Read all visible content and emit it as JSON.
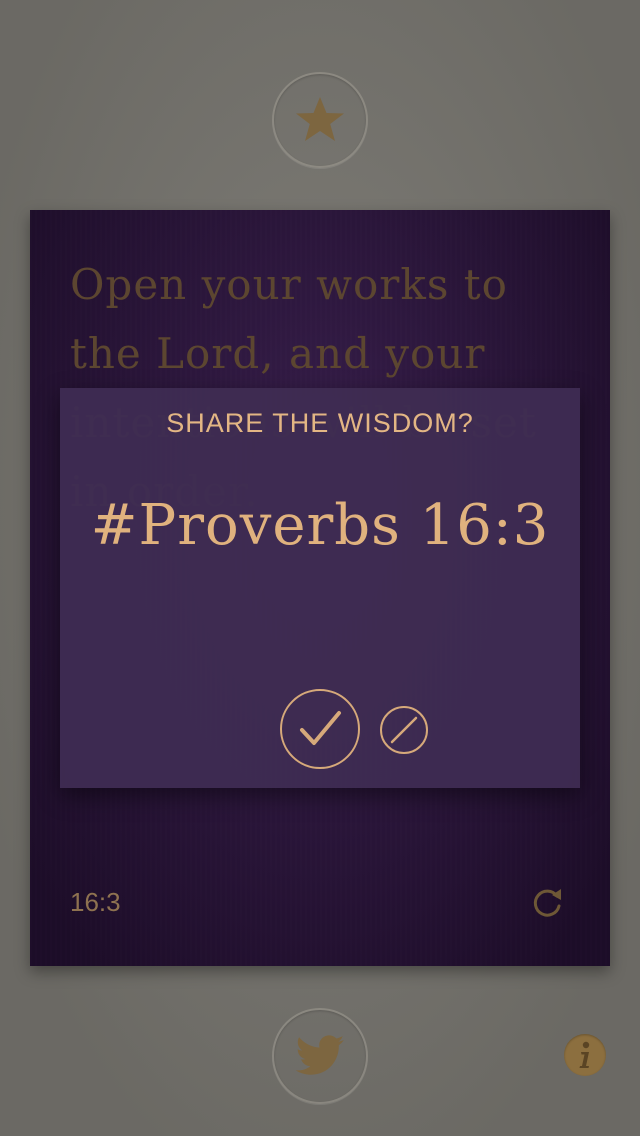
{
  "top_bar": {
    "favorite_icon": "star-icon"
  },
  "card": {
    "verse": "Open your works to the Lord, and your intentions will be set in order.",
    "reference": "16:3",
    "refresh_icon": "refresh-icon"
  },
  "share_dialog": {
    "title": "SHARE THE WISDOM?",
    "hashtag": "#Proverbs 16:3",
    "confirm_icon": "checkmark-icon",
    "cancel_icon": "cancel-icon"
  },
  "bottom_bar": {
    "share_icon": "twitter-icon",
    "info_icon": "info-icon"
  },
  "colors": {
    "background": "#77756f",
    "card": "#2a1438",
    "accent_gold": "#e0b27e",
    "dim_gold": "#8c6f3f"
  }
}
